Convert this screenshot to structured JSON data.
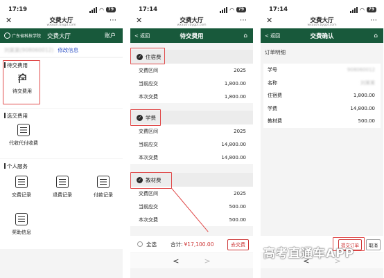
{
  "phones": [
    {
      "time": "17:19",
      "battery": "79",
      "wechat_title": "交费大厅",
      "wechat_url": "wxauth.bygpt.com",
      "header": {
        "logo_text": "广东省科技学院",
        "title": "交费大厅",
        "account": "账户"
      },
      "id_row": {
        "blurred": "刘某某(908060012)",
        "modify": "修改信息"
      },
      "sections": [
        {
          "title": "待交费用",
          "tiles": [
            "待交费用"
          ]
        },
        {
          "title": "选交费用",
          "tiles": [
            "代收代付收费"
          ]
        },
        {
          "title": "个人服务",
          "tiles": [
            "交费记录",
            "退费记录",
            "付款记录",
            "奖助信息"
          ]
        }
      ]
    },
    {
      "time": "17:14",
      "battery": "79",
      "wechat_title": "交费大厅",
      "wechat_url": "wxauth.bygpt.com",
      "header": {
        "back": "< 返回",
        "title": "待交费用"
      },
      "cards": [
        {
          "name": "住宿费",
          "rows": [
            [
              "交费区间",
              "2025"
            ],
            [
              "当前应交",
              "1,800.00"
            ],
            [
              "本次交费",
              "1,800.00"
            ]
          ]
        },
        {
          "name": "学费",
          "rows": [
            [
              "交费区间",
              "2025"
            ],
            [
              "当前应交",
              "14,800.00"
            ],
            [
              "本次交费",
              "14,800.00"
            ]
          ]
        },
        {
          "name": "教材费",
          "rows": [
            [
              "交费区间",
              "2025"
            ],
            [
              "当前应交",
              "500.00"
            ],
            [
              "本次交费",
              "500.00"
            ]
          ]
        }
      ],
      "footer": {
        "select_all": "全选",
        "total_label": "合计:",
        "total_value": "¥17,100.00",
        "pay_button": "去交费"
      }
    },
    {
      "time": "17:14",
      "battery": "79",
      "wechat_title": "交费大厅",
      "wechat_url": "wxauth.bygpt.com",
      "header": {
        "back": "< 返回",
        "title": "交费确认"
      },
      "order_label": "订单明细",
      "order_rows": [
        [
          "学号",
          "908060012"
        ],
        [
          "名称",
          "刘某某"
        ]
      ],
      "fee_rows": [
        [
          "住宿费",
          "1,800.00"
        ],
        [
          "学费",
          "14,800.00"
        ],
        [
          "教材费",
          "500.00"
        ]
      ],
      "footer": {
        "confirm": "提交订单",
        "cancel": "取消"
      }
    }
  ],
  "nav": {
    "back": "<",
    "forward": ">"
  },
  "watermark": "高考直通车APP",
  "colors": {
    "header_green": "#18593b",
    "highlight_red": "#e04848",
    "link_blue": "#3a5bc8"
  }
}
